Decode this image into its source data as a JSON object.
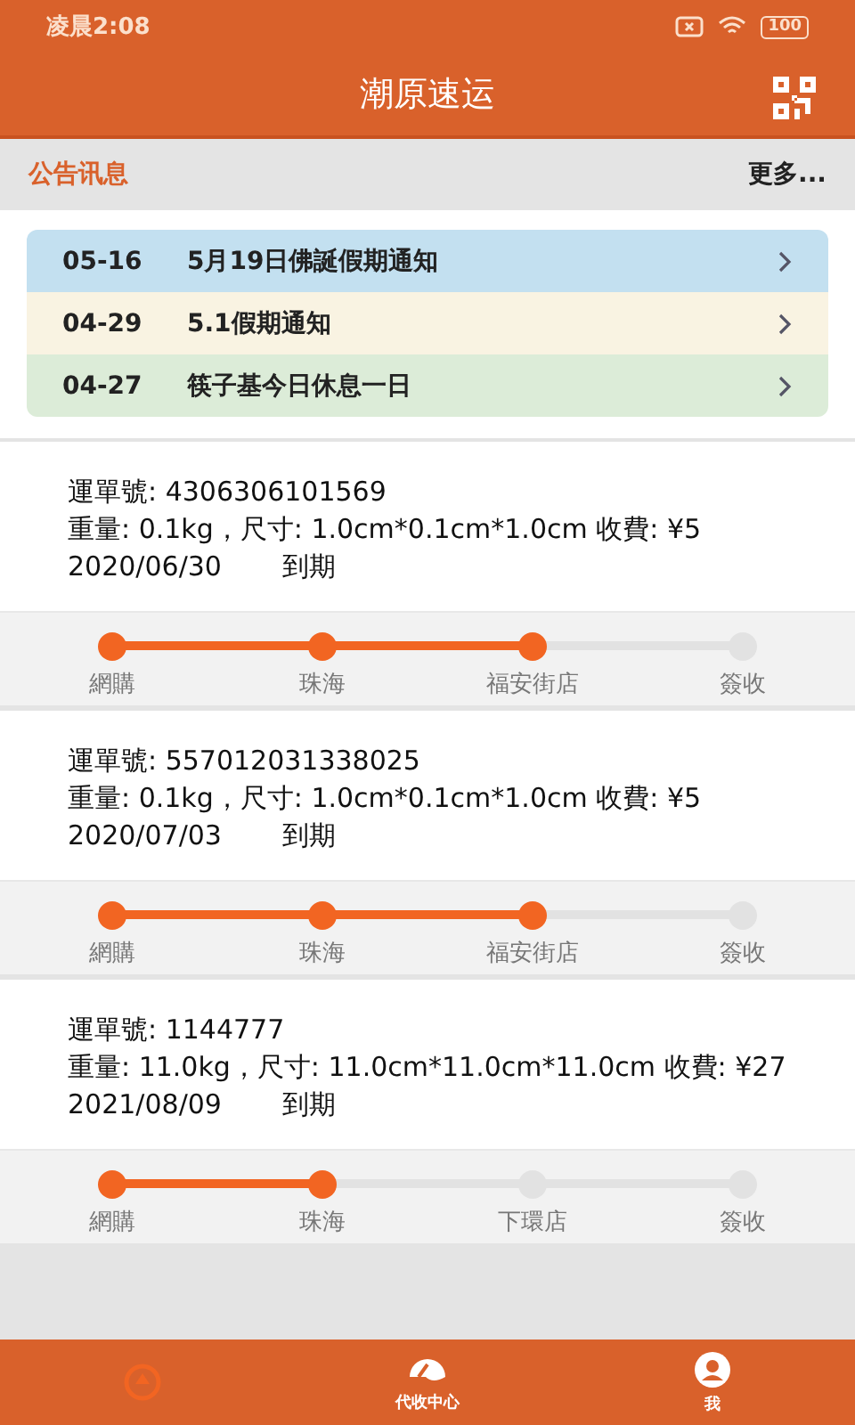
{
  "status_bar": {
    "time": "凌晨2:08",
    "battery": "100"
  },
  "header": {
    "title": "潮原速运"
  },
  "notices": {
    "title": "公告讯息",
    "more": "更多...",
    "items": [
      {
        "date": "05-16",
        "text": "5月19日佛誕假期通知",
        "color": "#c3e0f0"
      },
      {
        "date": "04-29",
        "text": "5.1假期通知",
        "color": "#f9f3e2"
      },
      {
        "date": "04-27",
        "text": "筷子基今日休息一日",
        "color": "#dcecd8"
      }
    ]
  },
  "shipments": [
    {
      "waybill": "運單號: 4306306101569",
      "details": "重量: 0.1kg，尺寸: 1.0cm*0.1cm*1.0cm 收費: ¥5",
      "date": "2020/06/30",
      "due": "到期",
      "steps": [
        {
          "label": "網購",
          "reached": true
        },
        {
          "label": "珠海",
          "reached": true
        },
        {
          "label": "福安街店",
          "reached": true
        },
        {
          "label": "簽收",
          "reached": false
        }
      ]
    },
    {
      "waybill": "運單號: 557012031338025",
      "details": "重量: 0.1kg，尺寸: 1.0cm*0.1cm*1.0cm 收費: ¥5",
      "date": "2020/07/03",
      "due": "到期",
      "steps": [
        {
          "label": "網購",
          "reached": true
        },
        {
          "label": "珠海",
          "reached": true
        },
        {
          "label": "福安街店",
          "reached": true
        },
        {
          "label": "簽收",
          "reached": false
        }
      ]
    },
    {
      "waybill": "運單號: 1144777",
      "details": "重量: 11.0kg，尺寸: 11.0cm*11.0cm*11.0cm 收費: ¥27",
      "date": "2021/08/09",
      "due": "到期",
      "steps": [
        {
          "label": "網購",
          "reached": true
        },
        {
          "label": "珠海",
          "reached": true
        },
        {
          "label": "下環店",
          "reached": false
        },
        {
          "label": "簽收",
          "reached": false
        }
      ]
    }
  ],
  "tab_bar": [
    {
      "kind": "home",
      "selected": true
    },
    {
      "kind": "collect",
      "label": "代收中心",
      "selected": false
    },
    {
      "kind": "me",
      "label": "我",
      "selected": false
    }
  ]
}
